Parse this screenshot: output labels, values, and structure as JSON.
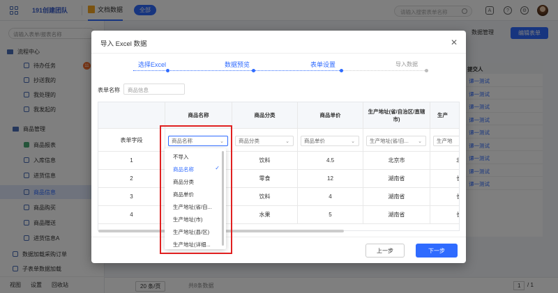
{
  "topbar": {
    "team": "191创建团队",
    "doc_label": "文档数据",
    "all_pill": "全部",
    "search_placeholder": "请输入搜索表单名称"
  },
  "sidebar": {
    "search_placeholder": "请输入表单/报表名称",
    "group1": "流程中心",
    "items1": [
      "待办任务",
      "抄送我的",
      "我处理的",
      "我发起的"
    ],
    "badge": "11",
    "group2": "商品管理",
    "items2": [
      "商品报表",
      "入库信息",
      "进货信息",
      "商品信息",
      "商品购买",
      "商品赠送",
      "进货信息A"
    ],
    "group3": "数据加载采购订单",
    "group4": "子表单数据加载",
    "bottom": [
      "视图",
      "设置",
      "回收站"
    ]
  },
  "main": {
    "data_manage": "数据管理",
    "edit_form": "编辑表单",
    "right_header": "提交人",
    "right_rows": [
      "谭一测试",
      "谭一测试",
      "谭一测试",
      "谭一测试",
      "谭一测试",
      "谭一测试",
      "谭一测试",
      "谭一测试",
      "谭一测试"
    ],
    "page_size": "20 条/页",
    "total": "共8条数据",
    "page": "1",
    "page_total": "/ 1"
  },
  "modal": {
    "title": "导入 Excel 数据",
    "steps": [
      "选择Excel",
      "数据预览",
      "表单设置",
      "导入数据"
    ],
    "form_name_label": "表单名称",
    "form_name_placeholder": "商品信息",
    "table": {
      "row_header": "表单字段",
      "headers": [
        "商品名称",
        "商品分类",
        "商品单价",
        "生产地址(省/自治区/直辖市)",
        "生产"
      ],
      "selects": [
        "商品名称",
        "商品分类",
        "商品单价",
        "生产地址(省/自...",
        "生产地"
      ],
      "rows": [
        [
          "1",
          "",
          "饮料",
          "4.5",
          "北京市",
          "北"
        ],
        [
          "2",
          "",
          "零食",
          "12",
          "湖南省",
          "长"
        ],
        [
          "3",
          "",
          "饮料",
          "4",
          "湖南省",
          "长"
        ],
        [
          "4",
          "",
          "水果",
          "5",
          "湖南省",
          "长"
        ]
      ]
    },
    "dropdown": [
      "不导入",
      "商品名称",
      "商品分类",
      "商品单价",
      "生产地址(省/自...",
      "生产地址(市)",
      "生产地址(县/区)",
      "生产地址(详细..."
    ],
    "dropdown_selected": 1,
    "prev_label": "上一步",
    "next_label": "下一步"
  },
  "colors": {
    "accent": "#2f6bff",
    "highlight_box": "#e02020"
  }
}
